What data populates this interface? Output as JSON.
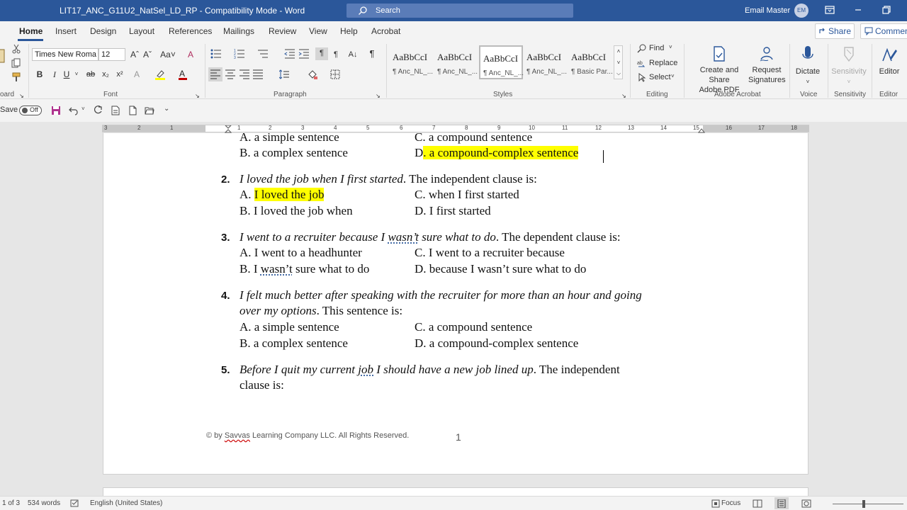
{
  "app": {
    "doc_title": "LIT17_ANC_G11U2_NatSel_LD_RP  -  Compatibility Mode  -  Word",
    "search_placeholder": "Search",
    "user_name": "Email Master",
    "user_initials": "EM"
  },
  "tabs": {
    "items": [
      "Home",
      "Insert",
      "Design",
      "Layout",
      "References",
      "Mailings",
      "Review",
      "View",
      "Help",
      "Acrobat"
    ],
    "active": "Home",
    "share_label": "Share",
    "comments_label": "Commen"
  },
  "ribbon": {
    "font_name": "Times New Roma",
    "font_size": "12",
    "groups": {
      "clipboard": "oard",
      "font": "Font",
      "paragraph": "Paragraph",
      "styles": "Styles",
      "editing": "Editing",
      "acrobat": "Adobe Acrobat",
      "voice": "Voice",
      "sensitivity": "Sensitivity",
      "editor": "Editor"
    },
    "styles": [
      {
        "sample": "AaBbCcI",
        "name": "¶ Anc_NL_..."
      },
      {
        "sample": "AaBbCcI",
        "name": "¶ Anc_NL_..."
      },
      {
        "sample": "AaBbCcI",
        "name": "¶ Anc_NL_..."
      },
      {
        "sample": "AaBbCcI",
        "name": "¶ Anc_NL_..."
      },
      {
        "sample": "AaBbCcI",
        "name": "¶ Basic Par..."
      }
    ],
    "editing": {
      "find": "Find",
      "replace": "Replace",
      "select": "Select"
    },
    "acrobat": {
      "create": "Create and Share",
      "create2": "Adobe PDF",
      "request": "Request",
      "request2": "Signatures"
    },
    "dictate": "Dictate",
    "sensitivity": "Sensitivity",
    "editor": "Editor"
  },
  "qat": {
    "autosave_label": "Save",
    "autosave_state": "Off"
  },
  "ruler": {
    "numbers": [
      "3",
      "2",
      "1",
      "1",
      "1",
      "2",
      "3",
      "4",
      "5",
      "6",
      "7",
      "8",
      "9",
      "10",
      "11",
      "12",
      "13",
      "14",
      "15",
      "16",
      "17",
      "18"
    ]
  },
  "document": {
    "top_a": "A. a simple sentence",
    "top_c": "C. a compound sentence",
    "top_b": "B. a complex sentence",
    "top_d_letter": "D",
    "top_d_text": ". a compound-complex sentence",
    "q2": {
      "num": "2.",
      "italic": "I loved the job when I first started",
      "rest": ". The independent clause is:",
      "a_pre": "A. ",
      "a_hl": "I loved the job",
      "c": "C. when I first started",
      "b": "B. I loved the job when",
      "d": "D. I first started"
    },
    "q3": {
      "num": "3.",
      "italic1": "I went to a recruiter because I ",
      "italic_sq": "wasn’t",
      "italic2": " sure what to do",
      "rest": ". The dependent clause is:",
      "a": "A. I went to a headhunter",
      "c": "C. I went to a recruiter because",
      "b_pre": "B. I ",
      "b_sq": "wasn’t",
      "b_post": " sure what to do",
      "d": "D. because I wasn’t sure what to do"
    },
    "q4": {
      "num": "4.",
      "line1": "I felt much better after speaking with the recruiter for more than an hour and going",
      "line2_it": "over my options",
      "line2_rest": ". This sentence is:",
      "a": "A. a simple sentence",
      "c": "C. a compound sentence",
      "b": "B. a complex sentence",
      "d": "D. a compound-complex sentence"
    },
    "q5": {
      "num": "5.",
      "it1": "Before I quit my current ",
      "it_sq": "job",
      "it2": " I should have a new job lined up",
      "rest": ". The independent",
      "line2": "clause is:"
    },
    "footer_pre": "© by ",
    "footer_sq": "Savvas",
    "footer_post": " Learning Company LLC. All Rights Reserved.",
    "page_number": "1"
  },
  "status": {
    "page": "1 of 3",
    "words": "534 words",
    "language": "English (United States)",
    "focus": "Focus"
  }
}
